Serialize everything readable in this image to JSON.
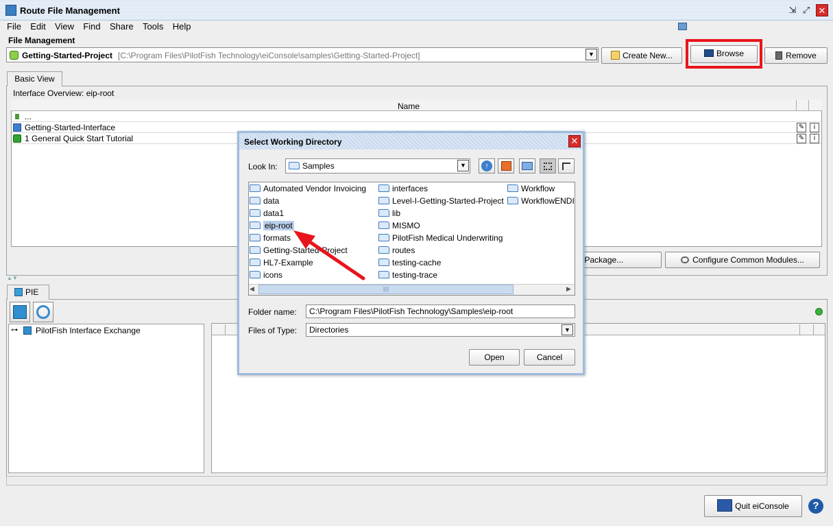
{
  "window": {
    "title": "Route File Management",
    "minimize_glyph": "⇲",
    "maximize_glyph": "⤢",
    "close_glyph": "✕"
  },
  "menu": [
    "File",
    "Edit",
    "View",
    "Find",
    "Share",
    "Tools",
    "Help"
  ],
  "file_management": {
    "label": "File Management",
    "project_name": "Getting-Started-Project",
    "project_path": "[C:\\Program Files\\PilotFish Technology\\eiConsole\\samples\\Getting-Started-Project]",
    "buttons": {
      "create_new": "Create New...",
      "browse": "Browse",
      "remove": "Remove"
    }
  },
  "basic_view": {
    "tab_label": "Basic View",
    "overview_label": "Interface Overview: eip-root",
    "column_name": "Name",
    "rows": [
      {
        "text": "..."
      },
      {
        "text": "Getting-Started-Interface"
      },
      {
        "text": "1 General Quick Start Tutorial"
      }
    ],
    "buttons": {
      "interface_package": "erface Package...",
      "configure_modules": "Configure Common Modules..."
    }
  },
  "pie": {
    "tab_label": "PIE",
    "tree_root": "PilotFish Interface Exchange",
    "status_color": "#39b23a"
  },
  "footer": {
    "quit_label": "Quit eiConsole",
    "help_glyph": "?"
  },
  "dialog": {
    "title": "Select Working Directory",
    "look_in_label": "Look In:",
    "look_in_value": "Samples",
    "folders": [
      "Automated Vendor Invoicing",
      "data",
      "data1",
      "eip-root",
      "formats",
      "Getting-Started-Project",
      "HL7-Example",
      "icons",
      "interfaces",
      "Level-I-Getting-Started-Project",
      "lib",
      "MISMO",
      "PilotFish Medical Underwriting",
      "routes",
      "testing-cache",
      "testing-trace",
      "Workflow",
      "WorkflowENDI"
    ],
    "selected_folder": "eip-root",
    "folder_name_label": "Folder name:",
    "folder_name_value": "C:\\Program Files\\PilotFish Technology\\Samples\\eip-root",
    "files_of_type_label": "Files of Type:",
    "files_of_type_value": "Directories",
    "open_label": "Open",
    "cancel_label": "Cancel",
    "close_glyph": "✕"
  },
  "annotation": {
    "highlight_color": "#e8141b"
  }
}
